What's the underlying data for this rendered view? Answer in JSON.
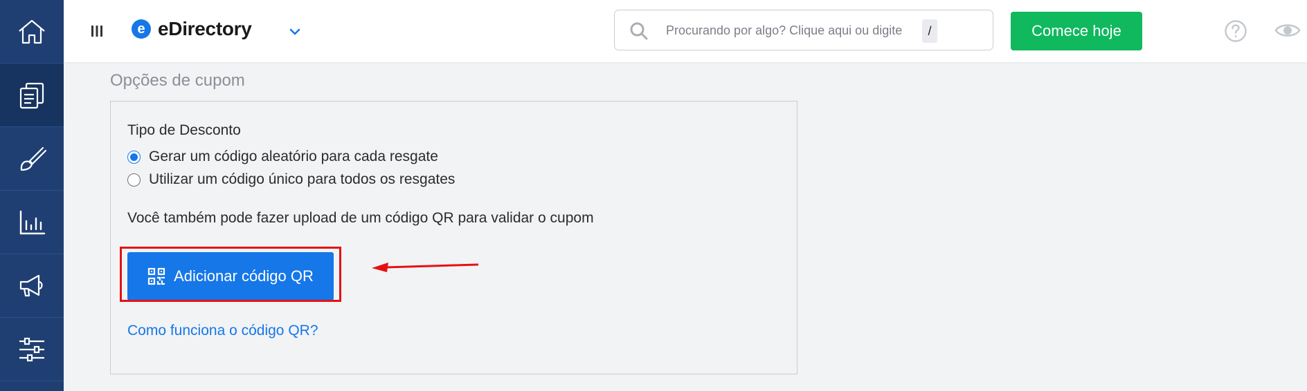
{
  "sidebar": {
    "items": [
      {
        "name": "home",
        "icon": "home-icon"
      },
      {
        "name": "content",
        "icon": "pages-icon",
        "active": true
      },
      {
        "name": "design",
        "icon": "brush-icon"
      },
      {
        "name": "reports",
        "icon": "bar-chart-icon"
      },
      {
        "name": "promote",
        "icon": "megaphone-icon"
      },
      {
        "name": "settings",
        "icon": "sliders-icon"
      }
    ],
    "color": "#1f3f73"
  },
  "topbar": {
    "brand_letter": "e",
    "brand_name": "eDirectory",
    "search": {
      "placeholder": "Procurando por algo? Clique aqui ou digite",
      "shortcut": "/"
    },
    "cta_label": "Comece hoje",
    "cta_color": "#10b85e"
  },
  "coupon_options": {
    "section_title": "Opções de cupom",
    "discount_type_label": "Tipo de Desconto",
    "radio_options": [
      {
        "label": "Gerar um código aleatório para cada resgate",
        "checked": true
      },
      {
        "label": "Utilizar um código único para todos os resgates",
        "checked": false
      }
    ],
    "qr_info_text": "Você também pode fazer upload de um código QR para validar o cupom",
    "qr_button_label": "Adicionar código QR",
    "qr_help_link": "Como funciona o código QR?",
    "accent_color": "#1677e8",
    "annotation_color": "#e51111"
  }
}
